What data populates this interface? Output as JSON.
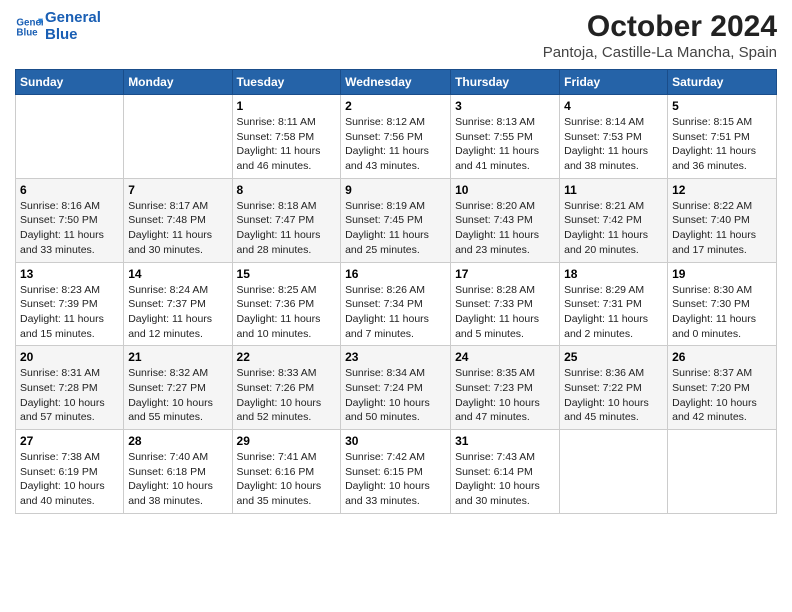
{
  "header": {
    "logo_line1": "General",
    "logo_line2": "Blue",
    "title": "October 2024",
    "subtitle": "Pantoja, Castille-La Mancha, Spain"
  },
  "weekdays": [
    "Sunday",
    "Monday",
    "Tuesday",
    "Wednesday",
    "Thursday",
    "Friday",
    "Saturday"
  ],
  "weeks": [
    [
      {
        "day": "",
        "info": ""
      },
      {
        "day": "",
        "info": ""
      },
      {
        "day": "1",
        "info": "Sunrise: 8:11 AM\nSunset: 7:58 PM\nDaylight: 11 hours\nand 46 minutes."
      },
      {
        "day": "2",
        "info": "Sunrise: 8:12 AM\nSunset: 7:56 PM\nDaylight: 11 hours\nand 43 minutes."
      },
      {
        "day": "3",
        "info": "Sunrise: 8:13 AM\nSunset: 7:55 PM\nDaylight: 11 hours\nand 41 minutes."
      },
      {
        "day": "4",
        "info": "Sunrise: 8:14 AM\nSunset: 7:53 PM\nDaylight: 11 hours\nand 38 minutes."
      },
      {
        "day": "5",
        "info": "Sunrise: 8:15 AM\nSunset: 7:51 PM\nDaylight: 11 hours\nand 36 minutes."
      }
    ],
    [
      {
        "day": "6",
        "info": "Sunrise: 8:16 AM\nSunset: 7:50 PM\nDaylight: 11 hours\nand 33 minutes."
      },
      {
        "day": "7",
        "info": "Sunrise: 8:17 AM\nSunset: 7:48 PM\nDaylight: 11 hours\nand 30 minutes."
      },
      {
        "day": "8",
        "info": "Sunrise: 8:18 AM\nSunset: 7:47 PM\nDaylight: 11 hours\nand 28 minutes."
      },
      {
        "day": "9",
        "info": "Sunrise: 8:19 AM\nSunset: 7:45 PM\nDaylight: 11 hours\nand 25 minutes."
      },
      {
        "day": "10",
        "info": "Sunrise: 8:20 AM\nSunset: 7:43 PM\nDaylight: 11 hours\nand 23 minutes."
      },
      {
        "day": "11",
        "info": "Sunrise: 8:21 AM\nSunset: 7:42 PM\nDaylight: 11 hours\nand 20 minutes."
      },
      {
        "day": "12",
        "info": "Sunrise: 8:22 AM\nSunset: 7:40 PM\nDaylight: 11 hours\nand 17 minutes."
      }
    ],
    [
      {
        "day": "13",
        "info": "Sunrise: 8:23 AM\nSunset: 7:39 PM\nDaylight: 11 hours\nand 15 minutes."
      },
      {
        "day": "14",
        "info": "Sunrise: 8:24 AM\nSunset: 7:37 PM\nDaylight: 11 hours\nand 12 minutes."
      },
      {
        "day": "15",
        "info": "Sunrise: 8:25 AM\nSunset: 7:36 PM\nDaylight: 11 hours\nand 10 minutes."
      },
      {
        "day": "16",
        "info": "Sunrise: 8:26 AM\nSunset: 7:34 PM\nDaylight: 11 hours\nand 7 minutes."
      },
      {
        "day": "17",
        "info": "Sunrise: 8:28 AM\nSunset: 7:33 PM\nDaylight: 11 hours\nand 5 minutes."
      },
      {
        "day": "18",
        "info": "Sunrise: 8:29 AM\nSunset: 7:31 PM\nDaylight: 11 hours\nand 2 minutes."
      },
      {
        "day": "19",
        "info": "Sunrise: 8:30 AM\nSunset: 7:30 PM\nDaylight: 11 hours\nand 0 minutes."
      }
    ],
    [
      {
        "day": "20",
        "info": "Sunrise: 8:31 AM\nSunset: 7:28 PM\nDaylight: 10 hours\nand 57 minutes."
      },
      {
        "day": "21",
        "info": "Sunrise: 8:32 AM\nSunset: 7:27 PM\nDaylight: 10 hours\nand 55 minutes."
      },
      {
        "day": "22",
        "info": "Sunrise: 8:33 AM\nSunset: 7:26 PM\nDaylight: 10 hours\nand 52 minutes."
      },
      {
        "day": "23",
        "info": "Sunrise: 8:34 AM\nSunset: 7:24 PM\nDaylight: 10 hours\nand 50 minutes."
      },
      {
        "day": "24",
        "info": "Sunrise: 8:35 AM\nSunset: 7:23 PM\nDaylight: 10 hours\nand 47 minutes."
      },
      {
        "day": "25",
        "info": "Sunrise: 8:36 AM\nSunset: 7:22 PM\nDaylight: 10 hours\nand 45 minutes."
      },
      {
        "day": "26",
        "info": "Sunrise: 8:37 AM\nSunset: 7:20 PM\nDaylight: 10 hours\nand 42 minutes."
      }
    ],
    [
      {
        "day": "27",
        "info": "Sunrise: 7:38 AM\nSunset: 6:19 PM\nDaylight: 10 hours\nand 40 minutes."
      },
      {
        "day": "28",
        "info": "Sunrise: 7:40 AM\nSunset: 6:18 PM\nDaylight: 10 hours\nand 38 minutes."
      },
      {
        "day": "29",
        "info": "Sunrise: 7:41 AM\nSunset: 6:16 PM\nDaylight: 10 hours\nand 35 minutes."
      },
      {
        "day": "30",
        "info": "Sunrise: 7:42 AM\nSunset: 6:15 PM\nDaylight: 10 hours\nand 33 minutes."
      },
      {
        "day": "31",
        "info": "Sunrise: 7:43 AM\nSunset: 6:14 PM\nDaylight: 10 hours\nand 30 minutes."
      },
      {
        "day": "",
        "info": ""
      },
      {
        "day": "",
        "info": ""
      }
    ]
  ]
}
